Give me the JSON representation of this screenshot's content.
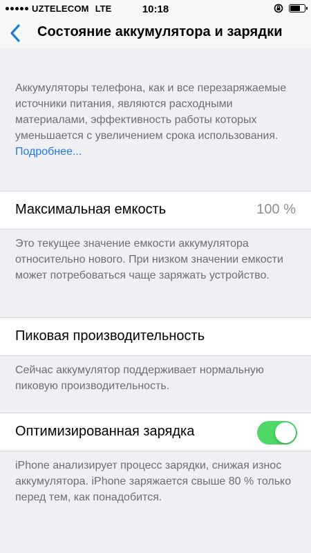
{
  "status_bar": {
    "carrier": "UZTELECOM",
    "network": "LTE",
    "time": "10:18",
    "icons": [
      "signal-dots-icon",
      "orientation-lock-icon",
      "battery-icon"
    ]
  },
  "nav": {
    "back_icon": "chevron-left-icon",
    "title": "Состояние аккумулятора и зарядки"
  },
  "intro": {
    "text": "Аккумуляторы телефона, как и все перезаряжаемые источники питания, являются расходными материалами, эффективность работы которых уменьшается с увеличением срока использования. ",
    "link": "Подробнее..."
  },
  "max_capacity": {
    "label": "Максимальная емкость",
    "value": "100 %",
    "footer": "Это текущее значение емкости аккумулятора относительно нового. При низком значении емкости может потребоваться чаще заряжать устройство."
  },
  "peak_performance": {
    "label": "Пиковая производительность",
    "footer": "Сейчас аккумулятор поддерживает нормальную пиковую производительность."
  },
  "optimized_charging": {
    "label": "Оптимизированная зарядка",
    "enabled": true,
    "footer": "iPhone анализирует процесс зарядки, снижая износ аккумулятора. iPhone заряжается свыше 80 % только перед тем, как понадобится."
  },
  "colors": {
    "background": "#efeff4",
    "link": "#1f7ae6",
    "toggle_on": "#4cd964",
    "secondary_text": "#6d6d72"
  }
}
